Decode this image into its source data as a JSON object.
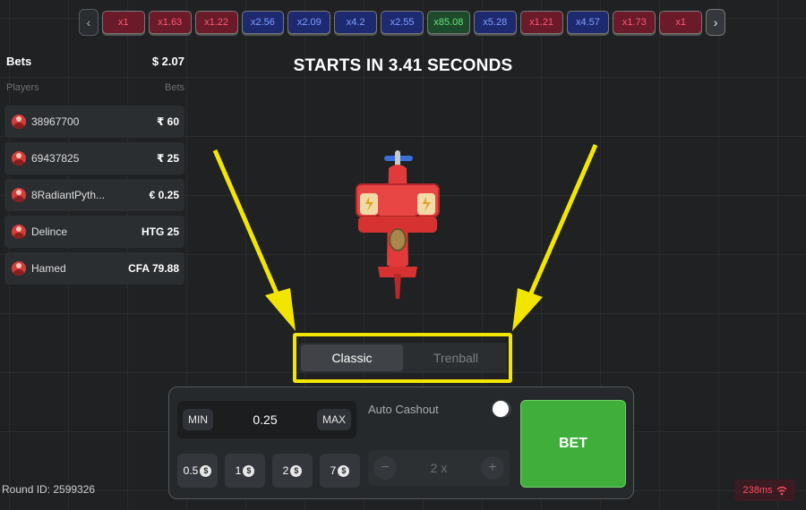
{
  "history": {
    "prev_icon": "‹",
    "next_icon": "›",
    "multipliers": [
      {
        "label": "x1",
        "color": "red"
      },
      {
        "label": "x1.63",
        "color": "red"
      },
      {
        "label": "x1.22",
        "color": "red"
      },
      {
        "label": "x2.56",
        "color": "blue"
      },
      {
        "label": "x2.09",
        "color": "blue"
      },
      {
        "label": "x4.2",
        "color": "blue"
      },
      {
        "label": "x2.55",
        "color": "blue"
      },
      {
        "label": "x85.08",
        "color": "green"
      },
      {
        "label": "x5.28",
        "color": "blue"
      },
      {
        "label": "x1.21",
        "color": "red"
      },
      {
        "label": "x4.57",
        "color": "blue"
      },
      {
        "label": "x1.73",
        "color": "red"
      },
      {
        "label": "x1",
        "color": "red"
      }
    ]
  },
  "sidebar": {
    "title": "Bets",
    "total": "$ 2.07",
    "col_players": "Players",
    "col_bets": "Bets",
    "players": [
      {
        "name": "38967700",
        "bet": "₹ 60"
      },
      {
        "name": "69437825",
        "bet": "₹ 25"
      },
      {
        "name": "8RadiantPyth...",
        "bet": "€ 0.25"
      },
      {
        "name": "Delince",
        "bet": "HTG 25"
      },
      {
        "name": "Hamed",
        "bet": "CFA 79.88"
      }
    ]
  },
  "countdown": "STARTS IN 3.41  SECONDS",
  "tabs": [
    "Classic",
    "Trenball"
  ],
  "panel": {
    "min_label": "MIN",
    "max_label": "MAX",
    "amount": "0.25",
    "quick": [
      {
        "value": "0.5",
        "icon": "$"
      },
      {
        "value": "1",
        "icon": "$"
      },
      {
        "value": "2",
        "icon": "$"
      },
      {
        "value": "7",
        "icon": "$"
      }
    ],
    "auto_cashout_label": "Auto Cashout",
    "minus": "−",
    "plus": "+",
    "cashout_value": "2 x",
    "bet_label": "BET"
  },
  "footer": {
    "round_id": "Round ID: 2599326",
    "ping": "238ms"
  },
  "colors": {
    "accent_green": "#3fae3a",
    "highlight_yellow": "#f2e600",
    "loss_red": "#ff5a73",
    "mid_blue": "#7f9dff"
  }
}
